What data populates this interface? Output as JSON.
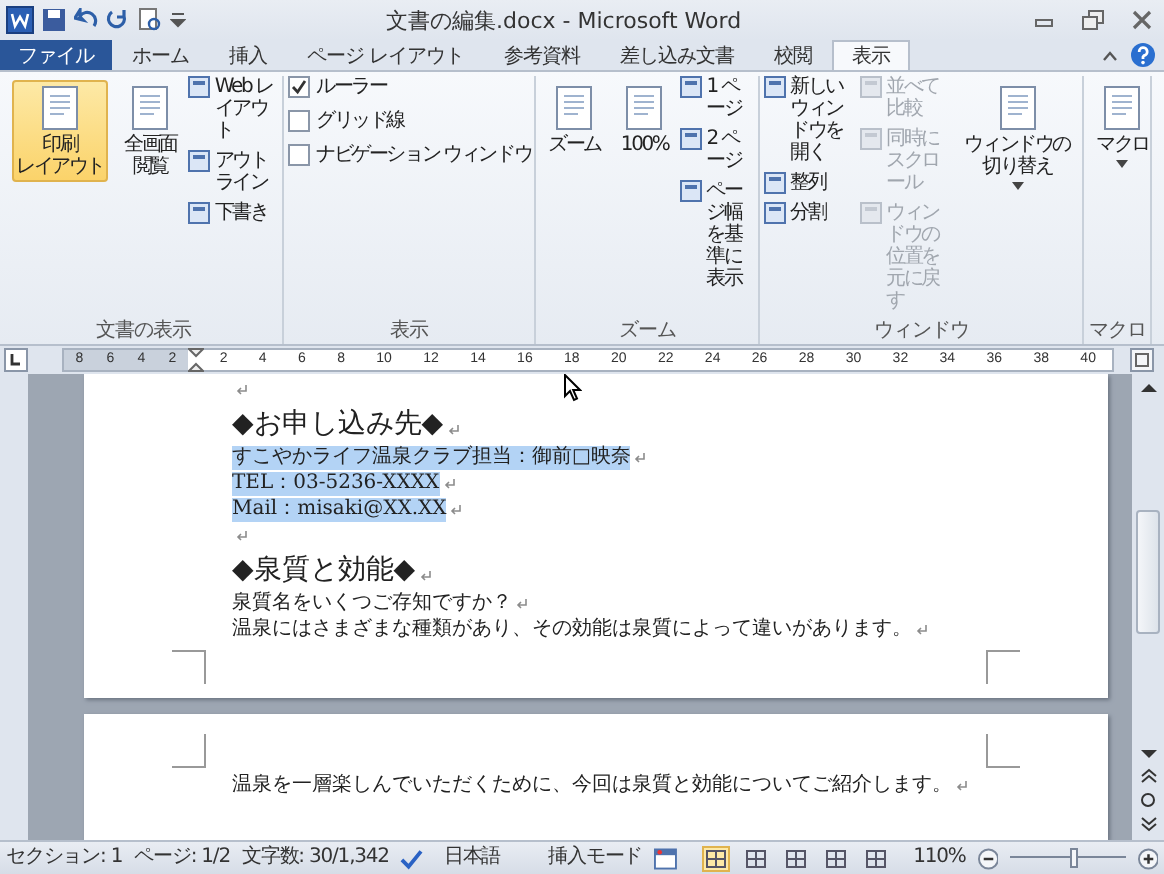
{
  "title_bar": {
    "title": "文書の編集.docx - Microsoft Word"
  },
  "tabs": [
    {
      "label": "ファイル",
      "kind": "file",
      "selected": false
    },
    {
      "label": "ホーム",
      "kind": "tab",
      "selected": false
    },
    {
      "label": "挿入",
      "kind": "tab",
      "selected": false
    },
    {
      "label": "ページ レイアウト",
      "kind": "tab",
      "selected": false
    },
    {
      "label": "参考資料",
      "kind": "tab",
      "selected": false
    },
    {
      "label": "差し込み文書",
      "kind": "tab",
      "selected": false
    },
    {
      "label": "校閲",
      "kind": "tab",
      "selected": false
    },
    {
      "label": "表示",
      "kind": "tab",
      "selected": true
    }
  ],
  "ribbon_groups": [
    {
      "label": "文書の表示",
      "columns": [
        [
          {
            "kind": "large",
            "lines": [
              "印刷",
              "レイアウト"
            ],
            "selected": true,
            "disabled": false
          }
        ],
        [
          {
            "kind": "large",
            "lines": [
              "全画面",
              "閲覧"
            ],
            "selected": false,
            "disabled": false
          }
        ],
        [
          {
            "kind": "small",
            "label": "Web レイアウト",
            "disabled": false
          },
          {
            "kind": "small",
            "label": "アウトライン",
            "disabled": false
          },
          {
            "kind": "small",
            "label": "下書き",
            "disabled": false
          }
        ]
      ]
    },
    {
      "label": "表示",
      "columns": [
        [
          {
            "kind": "check",
            "label": "ルーラー",
            "checked": true
          },
          {
            "kind": "check",
            "label": "グリッド線",
            "checked": false
          },
          {
            "kind": "check",
            "label": "ナビゲーション ウィンドウ",
            "checked": false
          }
        ]
      ]
    },
    {
      "label": "ズーム",
      "columns": [
        [
          {
            "kind": "large",
            "lines": [
              "ズーム"
            ],
            "selected": false,
            "disabled": false
          }
        ],
        [
          {
            "kind": "large",
            "lines": [
              "100%"
            ],
            "selected": false,
            "disabled": false
          }
        ],
        [
          {
            "kind": "small",
            "label": "1 ページ",
            "disabled": false
          },
          {
            "kind": "small",
            "label": "2 ページ",
            "disabled": false
          },
          {
            "kind": "small",
            "label": "ページ幅を基準に表示",
            "disabled": false
          }
        ]
      ]
    },
    {
      "label": "ウィンドウ",
      "columns": [
        [
          {
            "kind": "small",
            "label": "新しいウィンドウを開く",
            "disabled": false
          },
          {
            "kind": "small",
            "label": "整列",
            "disabled": false
          },
          {
            "kind": "small",
            "label": "分割",
            "disabled": false
          }
        ],
        [
          {
            "kind": "small",
            "label": "並べて比較",
            "disabled": true
          },
          {
            "kind": "small",
            "label": "同時にスクロール",
            "disabled": true
          },
          {
            "kind": "small",
            "label": "ウィンドウの位置を元に戻す",
            "disabled": true
          }
        ],
        [
          {
            "kind": "large",
            "lines": [
              "ウィンドウの",
              "切り替え"
            ],
            "selected": false,
            "disabled": false,
            "dropdown": true
          }
        ]
      ]
    },
    {
      "label": "マクロ",
      "columns": [
        [
          {
            "kind": "large",
            "lines": [
              "マクロ"
            ],
            "selected": false,
            "disabled": false,
            "dropdown": true
          }
        ]
      ]
    }
  ],
  "ruler": {
    "left_numbers": [
      "8",
      "6",
      "4",
      "2"
    ],
    "right_numbers": [
      "2",
      "4",
      "6",
      "8",
      "10",
      "12",
      "14",
      "16",
      "18",
      "20",
      "22",
      "24",
      "26",
      "28",
      "30",
      "32",
      "34",
      "36",
      "38",
      "40"
    ]
  },
  "pages": [
    {
      "paragraphs": [
        {
          "kind": "empty"
        },
        {
          "kind": "heading",
          "text": "◆お申し込み先◆",
          "selected": false
        },
        {
          "kind": "body",
          "text": "すこやかライフ温泉クラブ担当：御前□映奈",
          "selected": true
        },
        {
          "kind": "body",
          "text": "TEL：03-5236-XXXX",
          "selected": true
        },
        {
          "kind": "body",
          "text": "Mail：misaki@XX.XX",
          "selected": true
        },
        {
          "kind": "empty"
        },
        {
          "kind": "heading",
          "text": "◆泉質と効能◆",
          "selected": false
        },
        {
          "kind": "body",
          "text": "泉質名をいくつご存知ですか？",
          "selected": false
        },
        {
          "kind": "body",
          "text": "温泉にはさまざまな種類があり、その効能は泉質によって違いがあります。",
          "selected": false
        }
      ]
    },
    {
      "paragraphs": [
        {
          "kind": "body",
          "text": "温泉を一層楽しんでいただくために、今回は泉質と効能についてご紹介します。",
          "selected": false
        }
      ]
    }
  ],
  "status_bar": {
    "section": "セクション: 1",
    "page": "ページ: 1/2",
    "words": "文字数: 30/1,342",
    "language": "日本語",
    "mode": "挿入モード",
    "views": [
      {
        "selected": true
      },
      {
        "selected": false
      },
      {
        "selected": false
      },
      {
        "selected": false
      },
      {
        "selected": false
      }
    ],
    "zoom": "110%",
    "zoom_slider": {
      "level": 0.55
    }
  }
}
